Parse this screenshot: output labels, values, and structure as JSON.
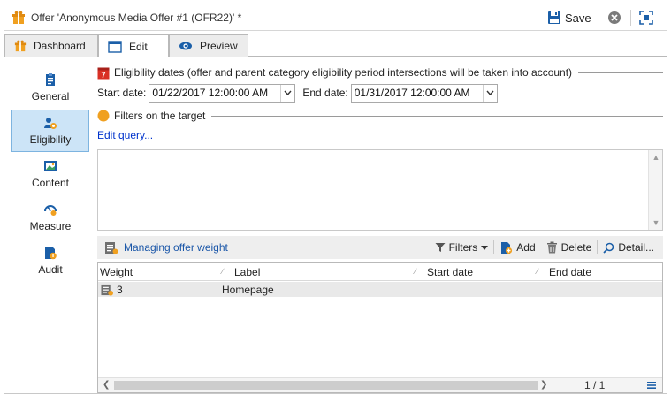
{
  "window": {
    "title": "Offer 'Anonymous Media Offer #1 (OFR22)' *",
    "save_label": "Save"
  },
  "tabs": [
    {
      "label": "Dashboard",
      "icon": "offer-gift-icon",
      "active": false
    },
    {
      "label": "Edit",
      "icon": "edit-window-icon",
      "active": true
    },
    {
      "label": "Preview",
      "icon": "eye-icon",
      "active": false
    }
  ],
  "sidebar": {
    "items": [
      {
        "label": "General",
        "icon": "clipboard-icon",
        "active": false
      },
      {
        "label": "Eligibility",
        "icon": "users-target-icon",
        "active": true
      },
      {
        "label": "Content",
        "icon": "image-icon",
        "active": false
      },
      {
        "label": "Measure",
        "icon": "gauge-icon",
        "active": false
      },
      {
        "label": "Audit",
        "icon": "audit-icon",
        "active": false
      }
    ]
  },
  "eligibility": {
    "section_title": "Eligibility dates (offer and parent category eligibility period intersections will be taken into account)",
    "calendar_day": "7",
    "start_label": "Start date:",
    "start_value": "01/22/2017 12:00:00 AM",
    "end_label": "End date:",
    "end_value": "01/31/2017 12:00:00 AM"
  },
  "filters": {
    "section_title": "Filters on the target",
    "edit_query_link": "Edit query..."
  },
  "weight_toolbar": {
    "title": "Managing offer weight",
    "filters_label": "Filters",
    "add_label": "Add",
    "delete_label": "Delete",
    "detail_label": "Detail..."
  },
  "grid": {
    "columns": [
      "Weight",
      "Label",
      "Start date",
      "End date"
    ],
    "rows": [
      {
        "weight": "3",
        "label": "Homepage",
        "start_date": "",
        "end_date": ""
      }
    ],
    "pager": "1 / 1"
  },
  "colors": {
    "accent": "#1a56a8",
    "selected_bg": "#cce4f7",
    "link": "#0033cc",
    "filter_dot": "#f0a020"
  }
}
